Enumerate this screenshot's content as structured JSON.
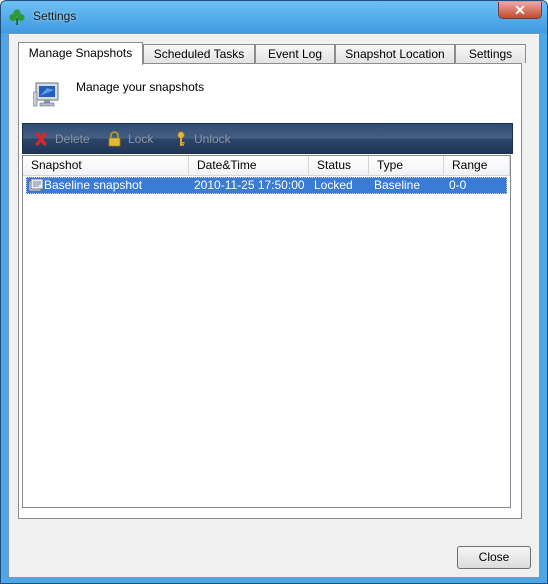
{
  "window": {
    "title": "Settings"
  },
  "tabs": [
    "Manage Snapshots",
    "Scheduled Tasks",
    "Event Log",
    "Snapshot Location",
    "Settings"
  ],
  "header": {
    "text": "Manage your snapshots"
  },
  "toolbar": {
    "delete_label": "Delete",
    "lock_label": "Lock",
    "unlock_label": "Unlock"
  },
  "table": {
    "columns": [
      "Snapshot",
      "Date&Time",
      "Status",
      "Type",
      "Range"
    ],
    "rows": [
      {
        "snapshot": "Baseline snapshot",
        "datetime": "2010-11-25 17:50:00",
        "status": "Locked",
        "type": "Baseline",
        "range": "0-0"
      }
    ]
  },
  "footer": {
    "close_label": "Close"
  },
  "colors": {
    "selection": "#3a7bd5",
    "toolbar": "#2f4d72",
    "title_bar": "#4da6e6"
  }
}
